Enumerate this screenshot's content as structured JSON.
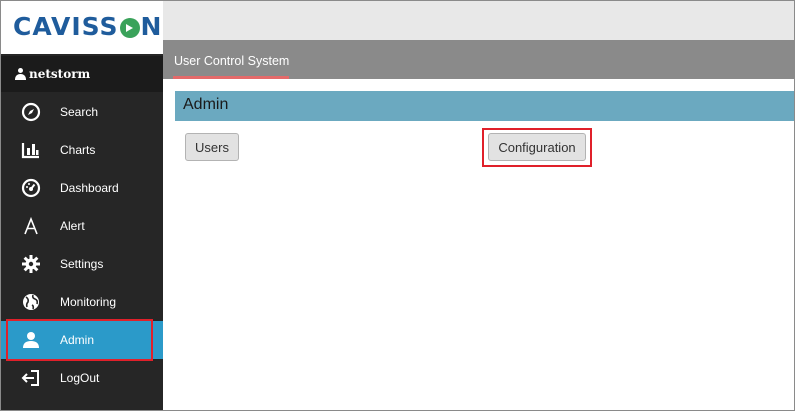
{
  "brand": {
    "logo_pre": "CAVISS",
    "logo_post": "N"
  },
  "user": {
    "name": "netstorm"
  },
  "sidebar": {
    "items": [
      {
        "label": "Search",
        "icon": "compass-icon"
      },
      {
        "label": "Charts",
        "icon": "bar-chart-icon"
      },
      {
        "label": "Dashboard",
        "icon": "dashboard-gauge-icon"
      },
      {
        "label": "Alert",
        "icon": "alert-a-icon"
      },
      {
        "label": "Settings",
        "icon": "gear-icon"
      },
      {
        "label": "Monitoring",
        "icon": "globe-icon"
      },
      {
        "label": "Admin",
        "icon": "user-icon",
        "active": true
      },
      {
        "label": "LogOut",
        "icon": "logout-icon"
      }
    ]
  },
  "tabs": {
    "active": "User Control System"
  },
  "section": {
    "title": "Admin"
  },
  "buttons": {
    "users": "Users",
    "configuration": "Configuration"
  },
  "colors": {
    "brand": "#1f5c9c",
    "sidebar": "#262626",
    "active": "#2b9ac9",
    "section": "#6ba9c0",
    "highlight": "#e0202a"
  }
}
